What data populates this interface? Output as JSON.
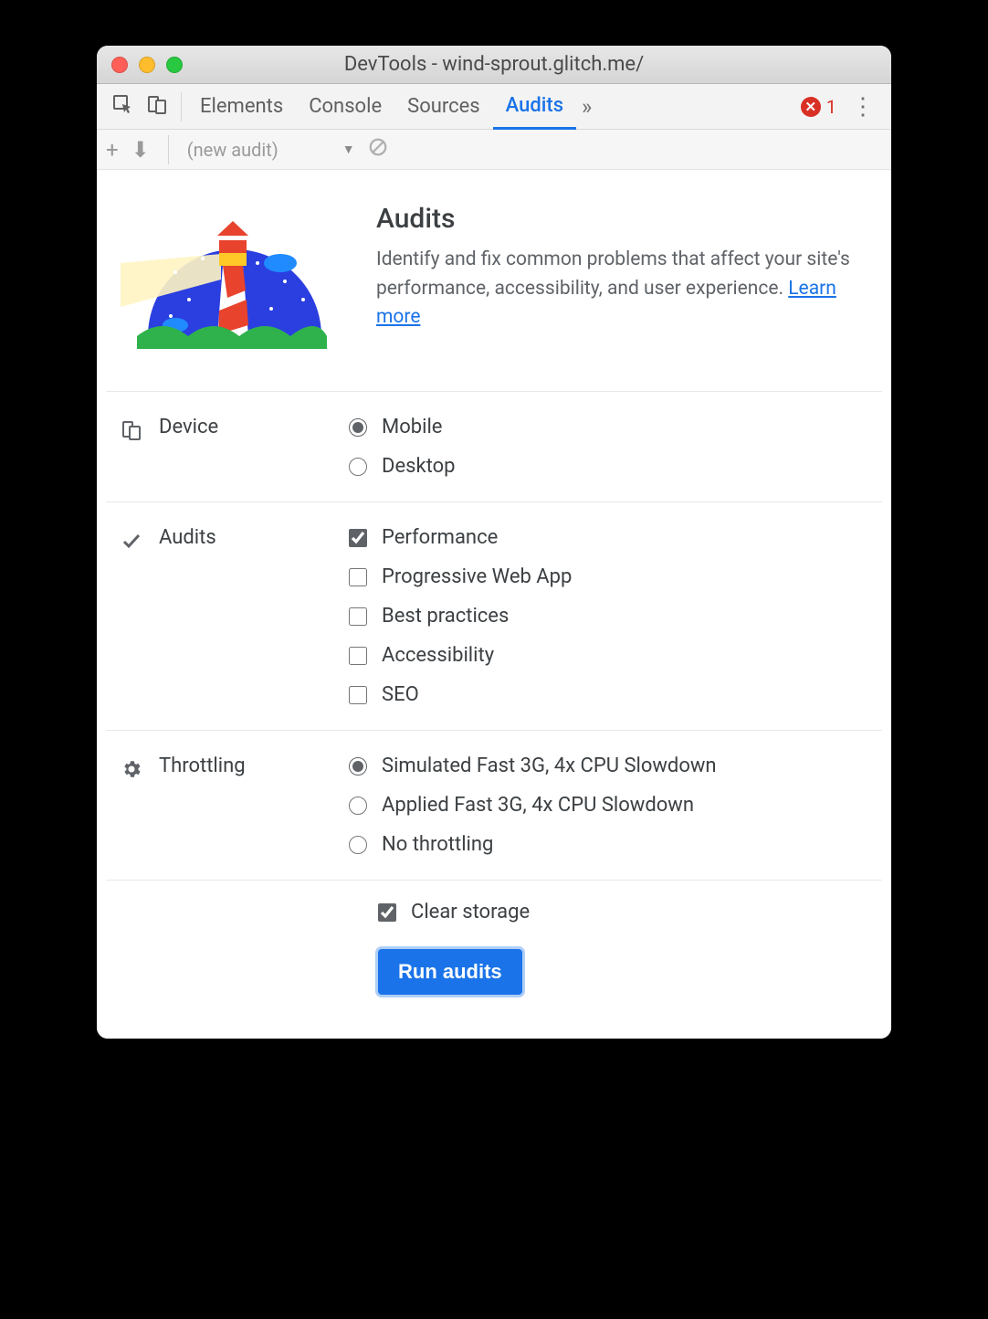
{
  "window": {
    "title": "DevTools - wind-sprout.glitch.me/"
  },
  "tabs": {
    "items": [
      "Elements",
      "Console",
      "Sources",
      "Audits"
    ],
    "active_index": 3,
    "overflow_glyph": "»",
    "error_count": "1"
  },
  "toolbar": {
    "new_glyph": "+",
    "download_glyph": "⬇",
    "audit_label": "(new audit)",
    "dropdown_glyph": "▼"
  },
  "intro": {
    "heading": "Audits",
    "body": "Identify and fix common problems that affect your site's performance, accessibility, and user experience. ",
    "learn_more": "Learn more"
  },
  "sections": {
    "device": {
      "label": "Device",
      "options": [
        {
          "label": "Mobile",
          "checked": true
        },
        {
          "label": "Desktop",
          "checked": false
        }
      ]
    },
    "audits": {
      "label": "Audits",
      "options": [
        {
          "label": "Performance",
          "checked": true
        },
        {
          "label": "Progressive Web App",
          "checked": false
        },
        {
          "label": "Best practices",
          "checked": false
        },
        {
          "label": "Accessibility",
          "checked": false
        },
        {
          "label": "SEO",
          "checked": false
        }
      ]
    },
    "throttling": {
      "label": "Throttling",
      "options": [
        {
          "label": "Simulated Fast 3G, 4x CPU Slowdown",
          "checked": true
        },
        {
          "label": "Applied Fast 3G, 4x CPU Slowdown",
          "checked": false
        },
        {
          "label": "No throttling",
          "checked": false
        }
      ]
    }
  },
  "clear_storage": {
    "label": "Clear storage",
    "checked": true
  },
  "run_button": "Run audits"
}
